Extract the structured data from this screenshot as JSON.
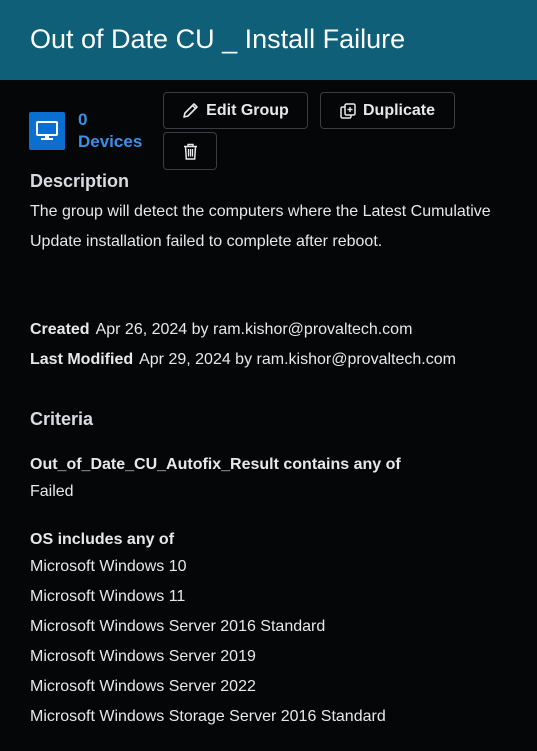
{
  "header": {
    "title": "Out of Date CU _ Install Failure"
  },
  "summary": {
    "device_count": "0",
    "device_label": "Devices",
    "device_icon": "monitor-icon"
  },
  "actions": {
    "edit_label": "Edit Group",
    "duplicate_label": "Duplicate",
    "edit_icon": "pencil-icon",
    "duplicate_icon": "duplicate-icon",
    "delete_icon": "trash-icon"
  },
  "description": {
    "title": "Description",
    "text": "The group will detect the computers where the Latest Cumulative Update installation failed to complete after reboot."
  },
  "meta": {
    "created_label": "Created",
    "created_value": "Apr 26, 2024 by ram.kishor@provaltech.com",
    "modified_label": "Last Modified",
    "modified_value": "Apr 29, 2024 by ram.kishor@provaltech.com"
  },
  "criteria": {
    "title": "Criteria",
    "rules": [
      {
        "label": "Out_of_Date_CU_Autofix_Result contains any of",
        "values": [
          "Failed"
        ]
      },
      {
        "label": "OS includes any of",
        "values": [
          "Microsoft Windows 10",
          "Microsoft Windows 11",
          "Microsoft Windows Server 2016 Standard",
          "Microsoft Windows Server 2019",
          "Microsoft Windows Server 2022",
          "Microsoft Windows Storage Server 2016 Standard"
        ]
      }
    ]
  },
  "colors": {
    "header_bg": "#0f5f79",
    "page_bg": "#050608",
    "link": "#3b8fe8",
    "device_icon_bg": "#0a6fd1"
  }
}
